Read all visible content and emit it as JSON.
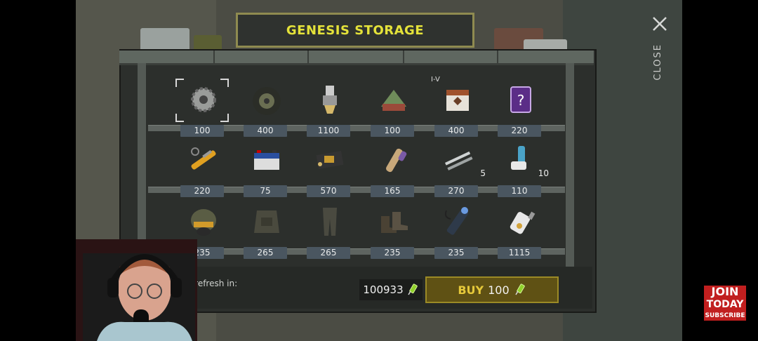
{
  "panel": {
    "title": "GENESIS STORAGE",
    "close_label": "CLOSE"
  },
  "shelves": [
    [
      {
        "icon": "gear-icon",
        "price": "100",
        "selected": true
      },
      {
        "icon": "wheel-icon",
        "price": "400"
      },
      {
        "icon": "spark-plug-icon",
        "price": "1100"
      },
      {
        "icon": "tent-icon",
        "price": "100"
      },
      {
        "icon": "crate-icon",
        "price": "400",
        "tier": "I-V"
      },
      {
        "icon": "mystery-card-icon",
        "price": "220"
      }
    ],
    [
      {
        "icon": "hydraulic-cylinder-icon",
        "price": "220"
      },
      {
        "icon": "battery-icon",
        "price": "75"
      },
      {
        "icon": "circuit-board-icon",
        "price": "570"
      },
      {
        "icon": "scroll-tubes-icon",
        "price": "165"
      },
      {
        "icon": "metal-rods-icon",
        "price": "270",
        "qty": "5"
      },
      {
        "icon": "inhaler-icon",
        "price": "110",
        "qty": "10"
      }
    ],
    [
      {
        "icon": "helmet-icon",
        "price": "235"
      },
      {
        "icon": "body-armor-icon",
        "price": "265"
      },
      {
        "icon": "cargo-pants-icon",
        "price": "265"
      },
      {
        "icon": "boots-icon",
        "price": "235"
      },
      {
        "icon": "flashlight-icon",
        "price": "235"
      },
      {
        "icon": "stun-device-icon",
        "price": "1115"
      }
    ]
  ],
  "footer": {
    "refresh_label": "l refresh in:",
    "balance": "100933",
    "buy_label": "BUY",
    "buy_amount": "100"
  },
  "overlay": {
    "join": "JOIN",
    "today": "TODAY",
    "subscribe": "SUBSCRIBE"
  },
  "colors": {
    "title_text": "#e4e23a",
    "buy_bg": "#5f5114",
    "currency": "#8fd12a"
  }
}
